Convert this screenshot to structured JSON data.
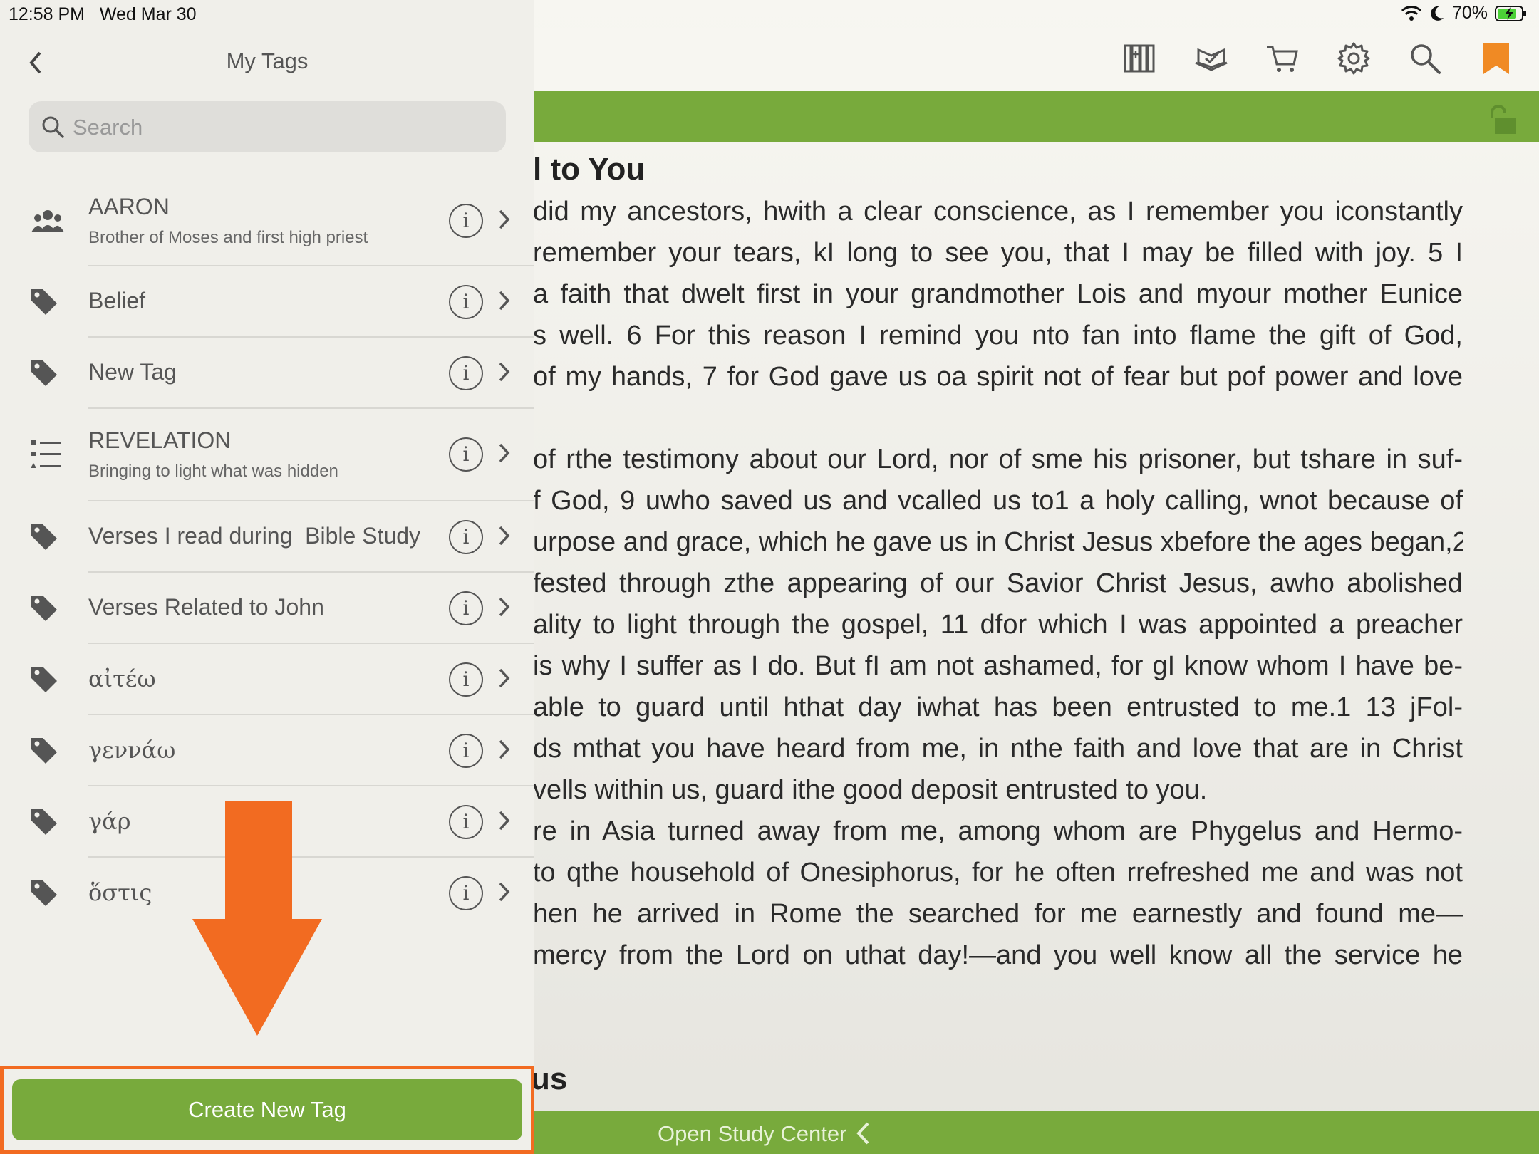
{
  "status": {
    "time": "12:58 PM",
    "date": "Wed Mar 30",
    "battery": "70%"
  },
  "panel": {
    "title": "My Tags",
    "search_placeholder": "Search",
    "tags": [
      {
        "name": "AARON",
        "desc": "Brother of Moses and first high priest",
        "icon": "people-icon"
      },
      {
        "name": "Belief",
        "icon": "tag-icon"
      },
      {
        "name": "New Tag",
        "icon": "tag-icon"
      },
      {
        "name": "REVELATION",
        "desc": "Bringing to light what was hidden",
        "icon": "list-icon"
      },
      {
        "name": "Verses I read during  Bible Study",
        "icon": "tag-icon"
      },
      {
        "name": "Verses Related to John",
        "icon": "tag-icon"
      },
      {
        "name": "αἰτέω",
        "icon": "tag-icon"
      },
      {
        "name": "γεννάω",
        "icon": "tag-icon"
      },
      {
        "name": "γάρ",
        "icon": "tag-icon"
      },
      {
        "name": "ὅστις",
        "icon": "tag-icon"
      }
    ],
    "create_label": "Create New Tag"
  },
  "reader": {
    "heading": "l to You",
    "lines": [
      "did my ancestors, hwith a clear conscience, as I remember you iconstantly",
      "remember your tears, kI long to see you, that I may be filled with joy.  5  I",
      "a faith that dwelt first in your grandmother Lois and myour mother Eunice",
      "s well.  6  For this reason I remind you nto fan into flame the gift of God,",
      " of my hands,  7  for God gave us oa spirit not of fear but pof power and love",
      "",
      "of rthe testimony about our Lord, nor of sme his prisoner, but tshare in suf-",
      "f God,  9  uwho saved us and vcalled us to1 a holy calling, wnot because of",
      "urpose and grace, which he gave us in Christ Jesus xbefore the ages began,2",
      "fested through zthe appearing of our Savior Christ Jesus, awho abolished",
      "ality to light through the gospel,  11  dfor which I was appointed a preacher",
      "is why I suffer as I do. But fI am not ashamed, for gI know whom I have be-",
      "able to guard until hthat day iwhat has been entrusted to me.1  13  jFol-",
      "ds mthat you have heard from me, in nthe faith and love that are in Christ",
      "vells within us, guard ithe good deposit entrusted to you.",
      "re in Asia turned away from me, among whom are Phygelus and Hermo-",
      " to qthe household of Onesiphorus, for he often rrefreshed me and was not",
      "hen he arrived in Rome the searched for me earnestly and found me—",
      "mercy from the Lord on uthat day!—and you well know all the service he"
    ],
    "bottom_heading": "us",
    "study_label": "Open Study Center"
  }
}
